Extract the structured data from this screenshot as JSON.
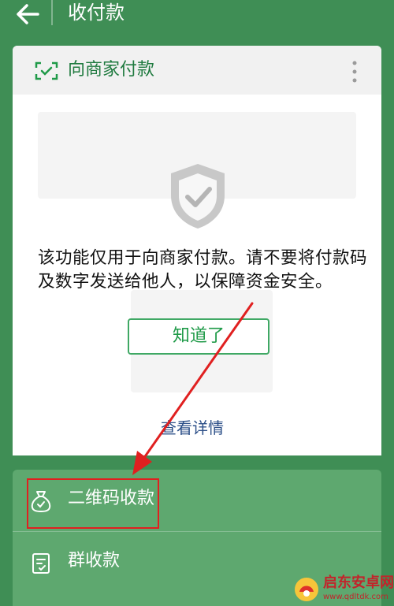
{
  "header": {
    "title": "收付款",
    "back_icon": "arrow-left-icon"
  },
  "payment_card": {
    "title": "向商家付款",
    "scan_icon": "scan-frame-icon",
    "more_icon": "more-vertical-icon",
    "shield_icon": "shield-check-icon",
    "notice_text": "该功能仅用于向商家付款。请不要将付款码及数字发送给他人，以保障资金安全。",
    "confirm_button": "知道了",
    "details_link": "查看详情"
  },
  "menu": {
    "items": [
      {
        "label": "二维码收款",
        "icon": "money-bag-icon"
      },
      {
        "label": "群收款",
        "icon": "group-receipt-icon"
      }
    ]
  },
  "annotation": {
    "highlight_color": "#e02020"
  },
  "watermark": {
    "name": "启东安卓网",
    "url": "www.qdltdk.com"
  },
  "colors": {
    "background": "#3f8e55",
    "menu_background": "#5ea86f",
    "accent_green": "#1f9a48",
    "link_blue": "#2c4f88"
  }
}
